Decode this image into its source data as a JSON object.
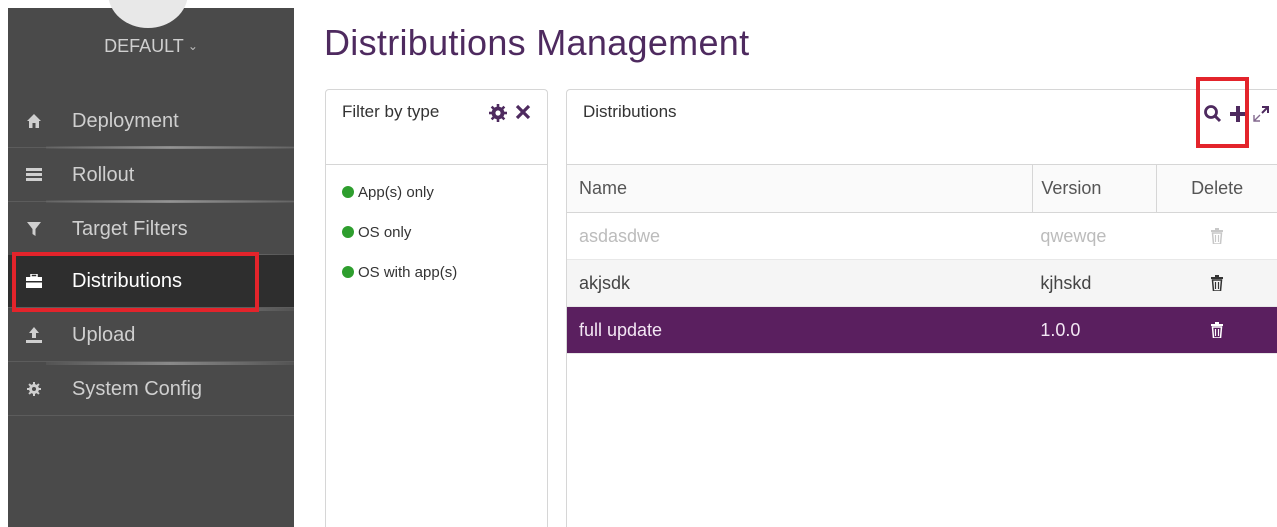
{
  "sidebar": {
    "tenant": "DEFAULT",
    "items": [
      {
        "label": "Deployment",
        "icon": "home-icon"
      },
      {
        "label": "Rollout",
        "icon": "list-icon"
      },
      {
        "label": "Target Filters",
        "icon": "filter-icon"
      },
      {
        "label": "Distributions",
        "icon": "briefcase-icon",
        "active": true
      },
      {
        "label": "Upload",
        "icon": "upload-icon"
      },
      {
        "label": "System Config",
        "icon": "gear-icon"
      }
    ]
  },
  "page": {
    "title": "Distributions Management"
  },
  "filter_panel": {
    "title": "Filter by type",
    "items": [
      "App(s) only",
      "OS only",
      "OS with app(s)"
    ],
    "dot_color": "#2e9e2e"
  },
  "distributions": {
    "title": "Distributions",
    "columns": {
      "name": "Name",
      "version": "Version",
      "delete": "Delete"
    },
    "rows": [
      {
        "name": "asdasdwe",
        "version": "qwewqe"
      },
      {
        "name": "akjsdk",
        "version": "kjhskd"
      },
      {
        "name": "full update",
        "version": "1.0.0"
      }
    ]
  },
  "colors": {
    "accent": "#5a1f5f",
    "highlight": "#e3242b",
    "sidebar": "#4a4a4a"
  }
}
